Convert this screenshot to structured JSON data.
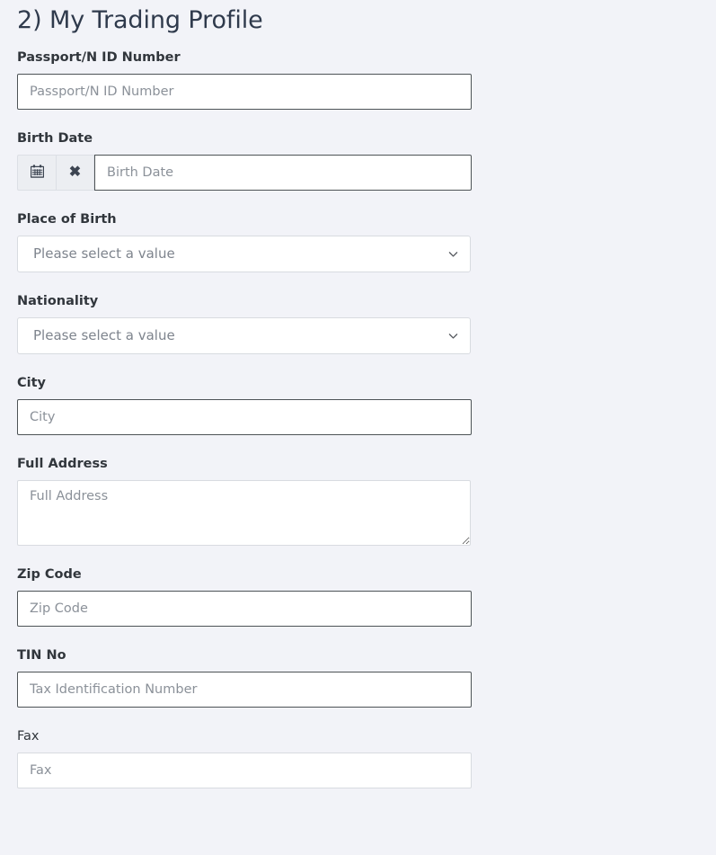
{
  "page": {
    "title": "2) My Trading Profile"
  },
  "colors": {
    "background": "#f2f3f8",
    "title_text": "#2f3a4c",
    "label_text": "#31363c",
    "placeholder_text": "#8b9199",
    "input_border_strong": "#4d5356",
    "input_border_soft": "#d8dbe0",
    "button_face": "#eceef2"
  },
  "fields": {
    "passport": {
      "label": "Passport/N ID Number",
      "placeholder": "Passport/N ID Number",
      "value": ""
    },
    "birth_date": {
      "label": "Birth Date",
      "placeholder": "Birth Date",
      "value": "",
      "calendar_button": "calendar-icon",
      "clear_button": "✖"
    },
    "place_of_birth": {
      "label": "Place of Birth",
      "selected": "Please select a value"
    },
    "nationality": {
      "label": "Nationality",
      "selected": "Please select a value"
    },
    "city": {
      "label": "City",
      "placeholder": "City",
      "value": ""
    },
    "full_address": {
      "label": "Full Address",
      "placeholder": "Full Address",
      "value": ""
    },
    "zip_code": {
      "label": "Zip Code",
      "placeholder": "Zip Code",
      "value": ""
    },
    "tin_no": {
      "label": "TIN No",
      "placeholder": "Tax Identification Number",
      "value": ""
    },
    "fax": {
      "label": "Fax",
      "placeholder": "Fax",
      "value": ""
    }
  }
}
